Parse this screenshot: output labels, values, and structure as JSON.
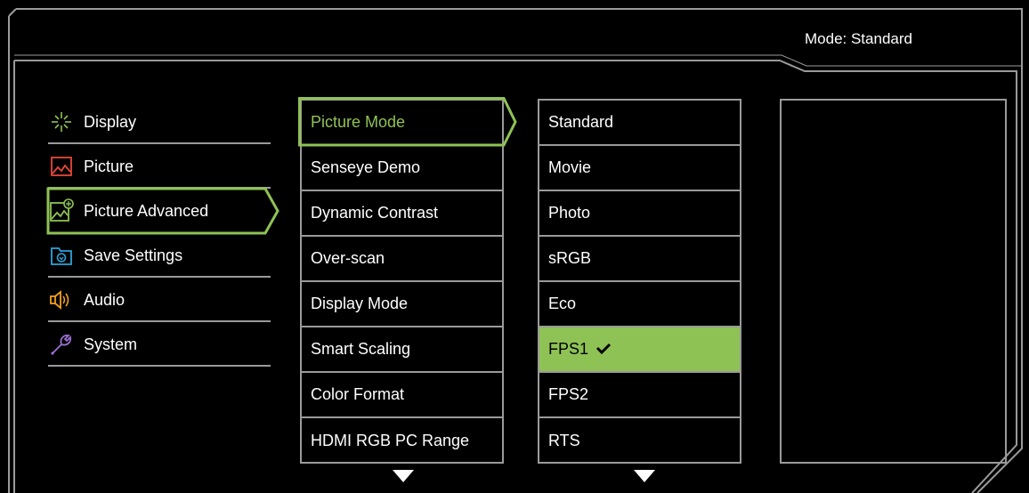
{
  "header": {
    "mode_label": "Mode: Standard"
  },
  "main_menu": {
    "items": [
      {
        "label": "Display",
        "icon": "display-icon"
      },
      {
        "label": "Picture",
        "icon": "picture-icon"
      },
      {
        "label": "Picture Advanced",
        "icon": "picture-advanced-icon",
        "active": true
      },
      {
        "label": "Save Settings",
        "icon": "save-settings-icon"
      },
      {
        "label": "Audio",
        "icon": "audio-icon"
      },
      {
        "label": "System",
        "icon": "system-icon"
      }
    ]
  },
  "submenu": {
    "items": [
      "Picture Mode",
      "Senseye Demo",
      "Dynamic Contrast",
      "Over-scan",
      "Display Mode",
      "Smart Scaling",
      "Color Format",
      "HDMI RGB PC Range"
    ],
    "more_icon": "arrow-down-icon"
  },
  "options": {
    "items": [
      "Standard",
      "Movie",
      "Photo",
      "sRGB",
      "Eco",
      "FPS1",
      "FPS2",
      "RTS"
    ],
    "selected": "FPS1",
    "selected_icon": "checkmark-icon",
    "more_icon": "arrow-down-icon"
  },
  "colors": {
    "accent_green": "#8fc255",
    "border_gray": "#9a9a9a",
    "background": "#000000",
    "picture_icon_red": "#e8473a",
    "save_icon_blue": "#2ea3dc",
    "audio_icon_orange": "#f2a01d",
    "system_icon_purple": "#9b6fd1"
  }
}
